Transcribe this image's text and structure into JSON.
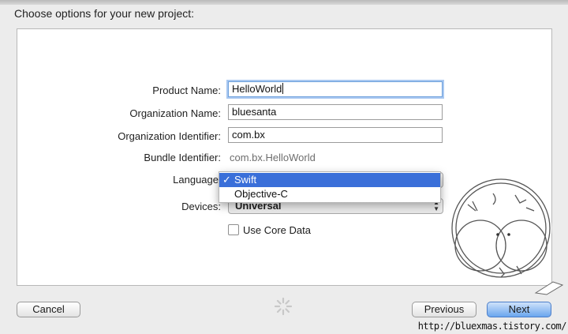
{
  "dialog": {
    "header": "Choose options for your new project:"
  },
  "form": {
    "product_name_label": "Product Name:",
    "product_name_value": "HelloWorld",
    "organization_name_label": "Organization Name:",
    "organization_name_value": "bluesanta",
    "organization_identifier_label": "Organization Identifier:",
    "organization_identifier_value": "com.bx",
    "bundle_identifier_label": "Bundle Identifier:",
    "bundle_identifier_value": "com.bx.HelloWorld",
    "language_label": "Language",
    "language_menu": {
      "checkmark": "✓",
      "options": [
        "Swift",
        "Objective-C"
      ],
      "selected": "Swift"
    },
    "devices_label": "Devices:",
    "devices_value": "Universal",
    "core_data_label": "Use Core Data",
    "core_data_checked": false
  },
  "footer": {
    "cancel_label": "Cancel",
    "previous_label": "Previous",
    "next_label": "Next"
  },
  "watermark": {
    "url": "http://bluexmas.tistory.com/"
  },
  "colors": {
    "focus_ring": "#a9c8f1",
    "menu_highlight": "#3a6fd9",
    "primary_button": "#6aa6ee"
  }
}
